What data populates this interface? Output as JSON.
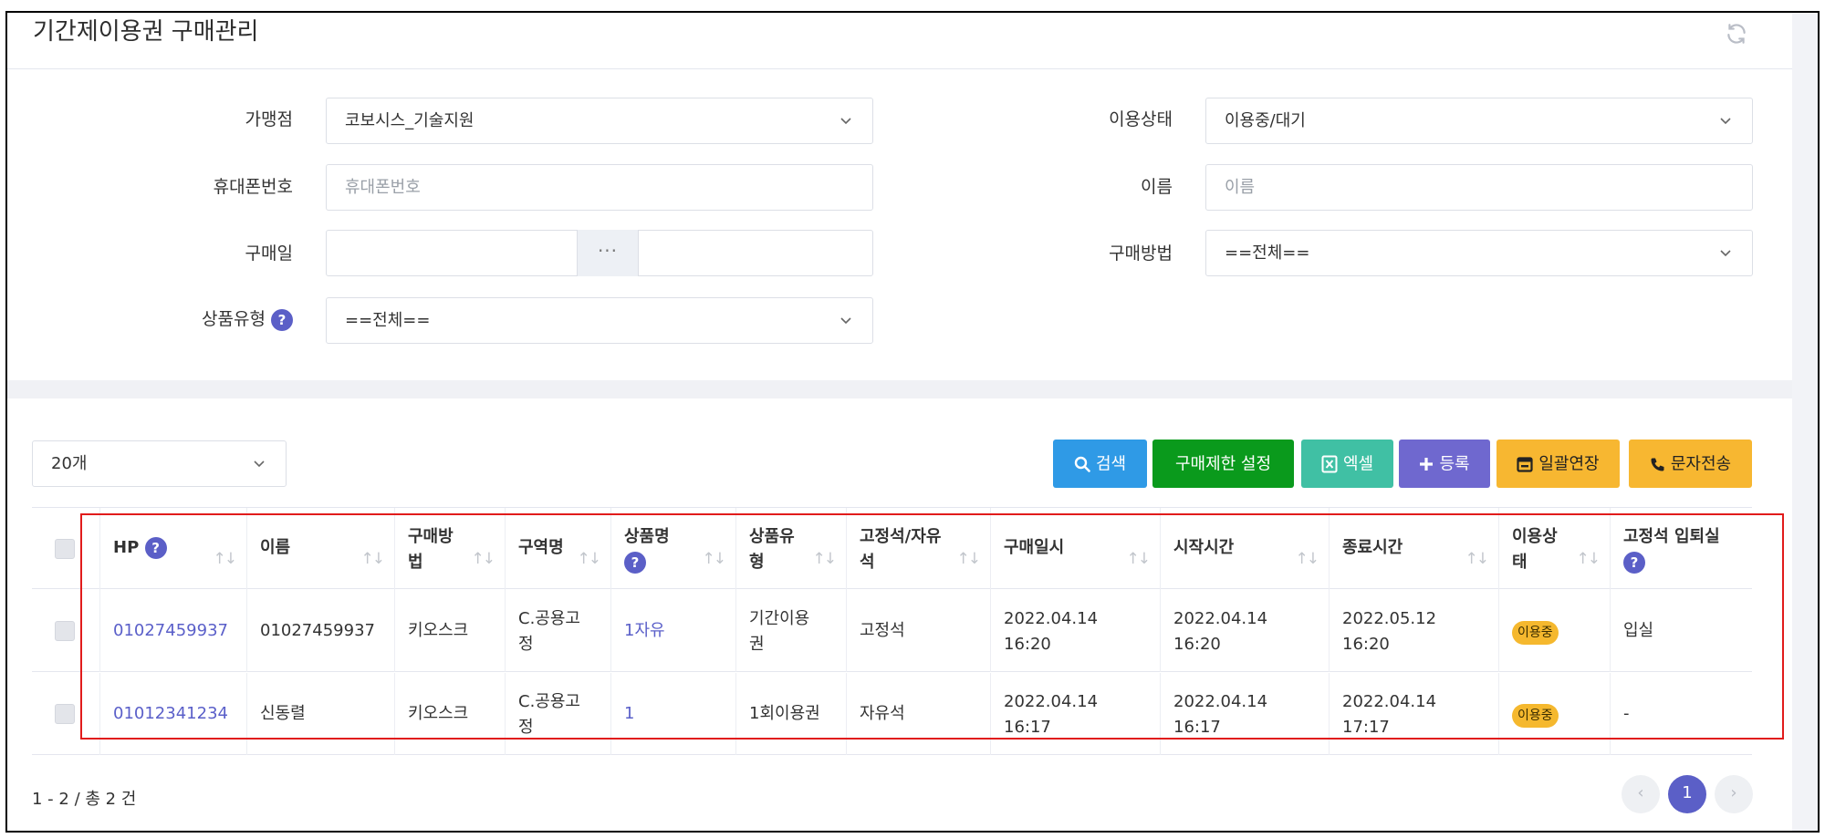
{
  "page": {
    "title": "기간제이용권 구매관리",
    "refresh_icon": "refresh-icon"
  },
  "filters": {
    "store": {
      "label": "가맹점",
      "value": "코보시스_기술지원"
    },
    "status": {
      "label": "이용상태",
      "value": "이용중/대기"
    },
    "phone": {
      "label": "휴대폰번호",
      "placeholder": "휴대폰번호"
    },
    "name": {
      "label": "이름",
      "placeholder": "이름"
    },
    "purchase_date": {
      "label": "구매일",
      "separator": "···"
    },
    "purchase_method": {
      "label": "구매방법",
      "value": "==전체=="
    },
    "product_type": {
      "label": "상품유형",
      "value": "==전체=="
    }
  },
  "toolbar": {
    "page_size": "20개",
    "search": "검색",
    "purchase_limit": "구매제한 설정",
    "excel": "엑셀",
    "register": "등록",
    "bulk_extend": "일괄연장",
    "sms": "문자전송"
  },
  "colors": {
    "search": "#2f9ae6",
    "purchase_limit": "#0a9a1c",
    "excel": "#40c0a4",
    "register": "#6f68cf",
    "bulk_extend": "#f7b731",
    "sms": "#f7b731",
    "accent": "#5b5fc7",
    "highlight": "#e11b1b"
  },
  "table": {
    "columns": {
      "hp": "HP",
      "name": "이름",
      "purchase_method": "구매방\n법",
      "zone": "구역명",
      "product": "상품명",
      "product_type": "상품유\n형",
      "seat_type": "고정석/자유\n석",
      "purchased_at": "구매일시",
      "start_time": "시작시간",
      "end_time": "종료시간",
      "status": "이용상\n태",
      "fixed_entry": "고정석 입퇴실"
    },
    "rows": [
      {
        "hp": "01027459937",
        "name": "01027459937",
        "purchase_method": "키오스크",
        "zone": "C.공용고\n정",
        "product": "1자유",
        "product_type": "기간이용\n권",
        "seat_type": "고정석",
        "purchased_at": "2022.04.14\n16:20",
        "start_time": "2022.04.14\n16:20",
        "end_time": "2022.05.12\n16:20",
        "status": "이용중",
        "fixed_entry": "입실"
      },
      {
        "hp": "01012341234",
        "name": "신동렬",
        "purchase_method": "키오스크",
        "zone": "C.공용고\n정",
        "product": "1",
        "product_type": "1회이용권",
        "seat_type": "자유석",
        "purchased_at": "2022.04.14\n16:17",
        "start_time": "2022.04.14\n16:17",
        "end_time": "2022.04.14\n17:17",
        "status": "이용중",
        "fixed_entry": "-"
      }
    ]
  },
  "footer": {
    "result_count": "1 - 2 / 총 2 건",
    "current_page": "1",
    "prev": "‹",
    "next": "›"
  }
}
